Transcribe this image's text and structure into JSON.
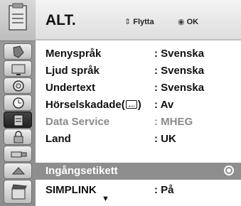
{
  "header": {
    "title": "ALT.",
    "hint_move": "Flytta",
    "hint_ok": "OK"
  },
  "menu": {
    "items": [
      {
        "label": "Menyspråk",
        "value": ": Svenska"
      },
      {
        "label": "Ljud språk",
        "value": ": Svenska"
      },
      {
        "label": "Undertext",
        "value": ": Svenska"
      },
      {
        "label_prefix": "Hörselskadade(",
        "label_suffix": ")",
        "value": ": Av"
      },
      {
        "label": "Data Service",
        "value": ": MHEG"
      },
      {
        "label": "Land",
        "value": ": UK"
      },
      {
        "label": "Ingångsetikett",
        "value": ""
      },
      {
        "label": "SIMPLINK",
        "value": ": På"
      }
    ]
  },
  "sidebar": {
    "icons": [
      "input-icon",
      "setup-icon",
      "picture-icon",
      "audio-icon",
      "time-icon",
      "option-icon",
      "lock-icon",
      "usb-icon",
      "movie-icon"
    ]
  },
  "colors": {
    "selected_row": "#8e8e8e",
    "disabled_text": "#8a8a8a"
  }
}
